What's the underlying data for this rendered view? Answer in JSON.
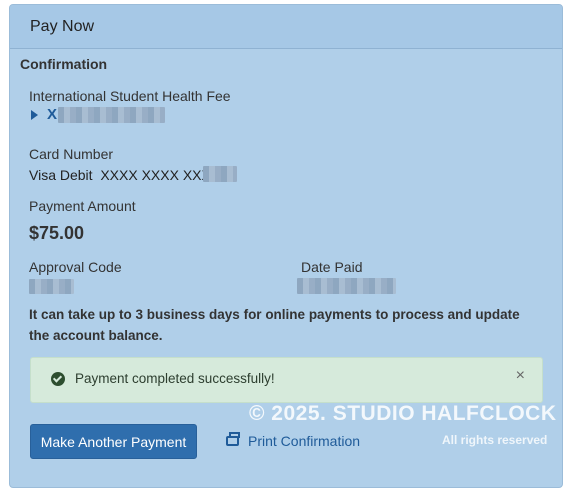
{
  "header": {
    "title": "Pay Now"
  },
  "confirmation": {
    "section_title": "Confirmation",
    "fee_label": "International Student Health Fee",
    "fee_link_prefix": "X",
    "card_number_label": "Card Number",
    "card_number_value": "Visa Debit  XXXX XXXX XXXX",
    "payment_amount_label": "Payment Amount",
    "payment_amount_value": "$75.00",
    "approval_code_label": "Approval Code",
    "date_paid_label": "Date Paid",
    "note": "It can take up to 3 business days for online payments to process and update the account balance."
  },
  "alert": {
    "message": "Payment completed successfully!",
    "close_symbol": "×",
    "icon": "check-circle-icon",
    "background_color": "#d6eadb"
  },
  "actions": {
    "make_another_payment_label": "Make Another Payment",
    "print_confirmation_label": "Print Confirmation",
    "print_icon": "printer-icon"
  },
  "watermark": {
    "main": "© 2025. STUDIO HALFCLOCK",
    "sub": "All rights reserved"
  },
  "colors": {
    "panel_background": "#b0cfe9",
    "link": "#1f5b99",
    "primary_button": "#2f6ead"
  }
}
